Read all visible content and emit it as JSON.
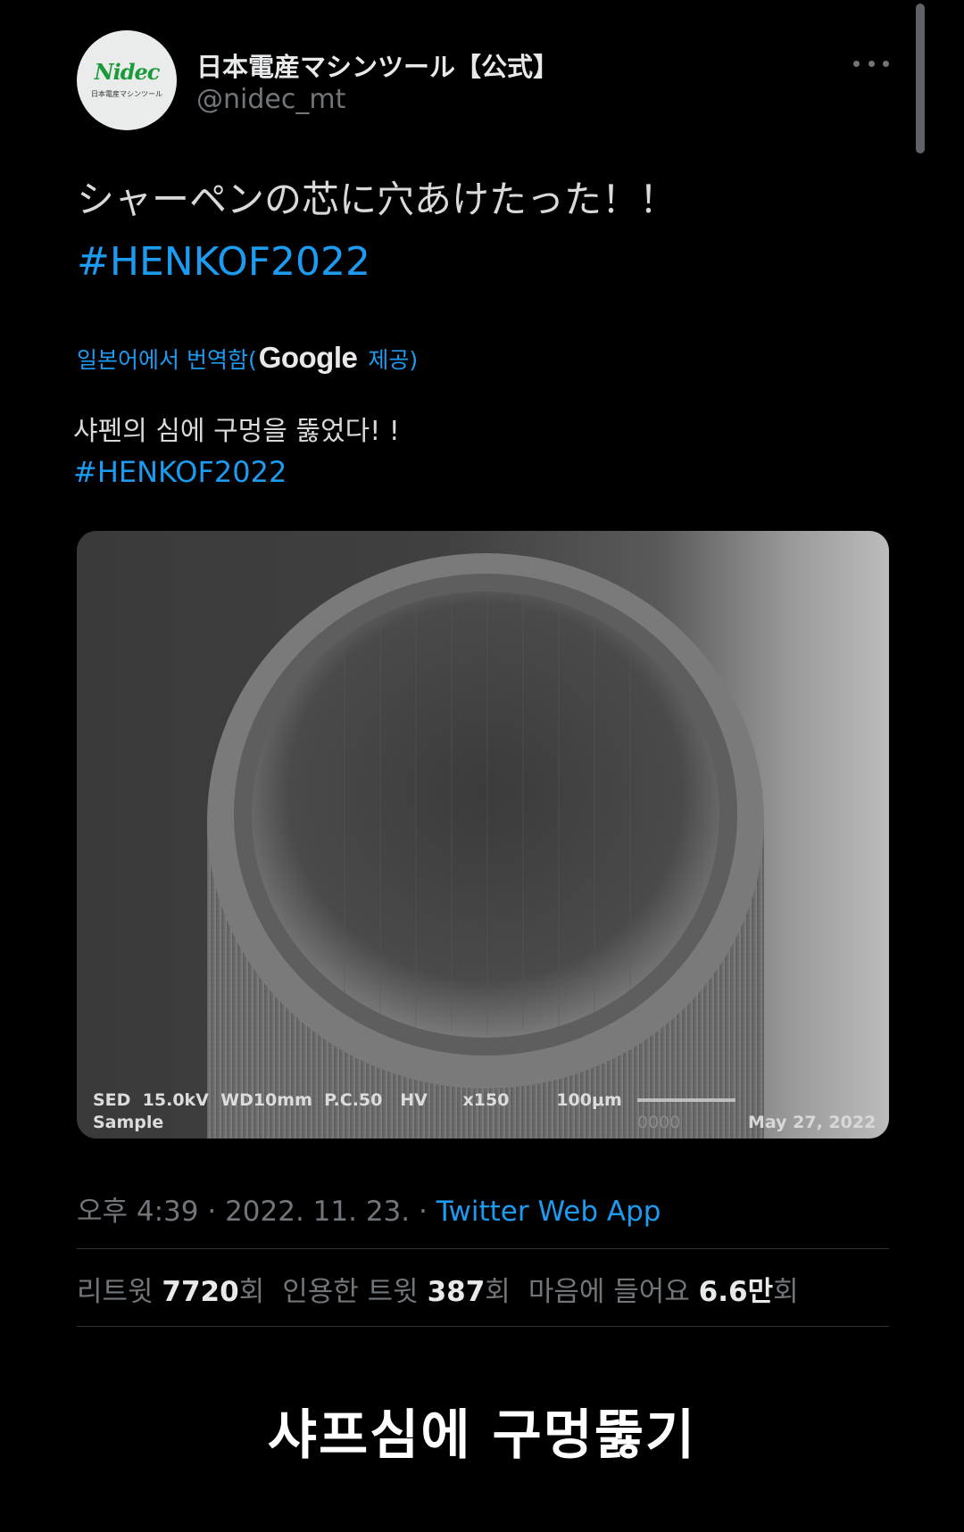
{
  "author": {
    "display_name": "日本電産マシンツール【公式】",
    "handle": "@nidec_mt",
    "avatar_logo": "Nidec",
    "avatar_sub": "日本電産マシンツール"
  },
  "tweet": {
    "text": "シャーペンの芯に穴あけたった！！",
    "hashtag": "#HENKOF2022"
  },
  "translation": {
    "label": "일본어에서 번역함(",
    "provider": "Google",
    "suffix": "제공)",
    "text": "샤펜의 심에 구멍을 뚫었다! !",
    "hashtag": "#HENKOF2022"
  },
  "media": {
    "info_line": "SED  15.0kV  WD10mm  P.C.50   HV      x150        100μm",
    "sample_label": "Sample",
    "code": "0000",
    "date": "May 27, 2022"
  },
  "meta": {
    "time": "오후 4:39 · 2022. 11. 23. · ",
    "source": "Twitter Web App"
  },
  "stats": {
    "retweet_label": "리트윗",
    "retweet_count": "7720",
    "retweet_unit": "회",
    "quote_label": "인용한 트윗",
    "quote_count": "387",
    "quote_unit": "회",
    "like_label": "마음에 들어요",
    "like_count": "6.6만",
    "like_unit": "회"
  },
  "caption": "샤프심에 구멍뚫기",
  "colors": {
    "background": "#000000",
    "link": "#1d9bf0",
    "muted": "#71767b"
  },
  "icons": [
    "more-options-icon"
  ]
}
